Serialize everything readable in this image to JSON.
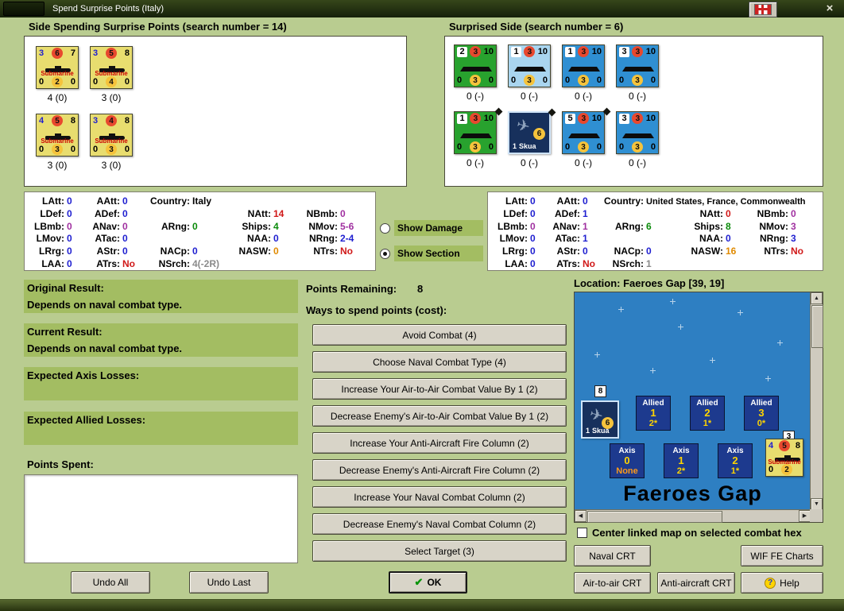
{
  "window": {
    "title": "Spend Surprise Points (Italy)"
  },
  "spending_panel": {
    "header": "Side Spending Surprise Points (search number = 14)",
    "counters": [
      {
        "top_left": "3",
        "top_mid": "6",
        "top_right": "7",
        "unit": "Submarine",
        "bot_left": "0",
        "bot_mid": "2",
        "bot_right": "0",
        "label": "4 (0)"
      },
      {
        "top_left": "3",
        "top_mid": "5",
        "top_right": "8",
        "unit": "Submarine",
        "bot_left": "0",
        "bot_mid": "4",
        "bot_right": "0",
        "label": "3 (0)"
      },
      {
        "top_left": "4",
        "top_mid": "5",
        "top_right": "8",
        "unit": "Submarine",
        "bot_left": "0",
        "bot_mid": "3",
        "bot_right": "0",
        "label": "3 (0)"
      },
      {
        "top_left": "3",
        "top_mid": "4",
        "top_right": "8",
        "unit": "Submarine",
        "bot_left": "0",
        "bot_mid": "3",
        "bot_right": "0",
        "label": "3 (0)"
      }
    ]
  },
  "surprised_panel": {
    "header": "Surprised Side (search number = 6)",
    "counters": [
      {
        "ship": true,
        "cls": "green",
        "top_left": "2",
        "top_mid": "3",
        "top_right": "10",
        "bot_left": "0",
        "bot_mid": "3",
        "bot_right": "0",
        "label": "0 (-)"
      },
      {
        "ship": true,
        "cls": "paleblue",
        "top_left": "1",
        "top_mid": "3",
        "top_right": "10",
        "bot_left": "0",
        "bot_mid": "3",
        "bot_right": "0",
        "label": "0 (-)"
      },
      {
        "ship": true,
        "cls": "blue",
        "top_left": "1",
        "top_mid": "3",
        "top_right": "10",
        "bot_left": "0",
        "bot_mid": "3",
        "bot_right": "0",
        "label": "0 (-)"
      },
      {
        "ship": true,
        "cls": "blue",
        "top_left": "3",
        "top_mid": "3",
        "top_right": "10",
        "bot_left": "0",
        "bot_mid": "3",
        "bot_right": "0",
        "label": "0 (-)"
      },
      {
        "ship": true,
        "cls": "green",
        "diamond": true,
        "top_left": "1",
        "top_mid": "3",
        "top_right": "10",
        "bot_left": "0",
        "bot_mid": "3",
        "bot_right": "0",
        "label": "0 (-)"
      },
      {
        "air": true,
        "cls": "navy selected",
        "diamond": true,
        "num": "1",
        "name": "Skua",
        "value": "6",
        "label": "0 (-)"
      },
      {
        "ship": true,
        "cls": "blue",
        "diamond": true,
        "top_left": "5",
        "top_mid": "3",
        "top_right": "10",
        "bot_left": "0",
        "bot_mid": "3",
        "bot_right": "0",
        "label": "0 (-)"
      },
      {
        "ship": true,
        "cls": "blue",
        "top_left": "3",
        "top_mid": "3",
        "top_right": "10",
        "bot_left": "0",
        "bot_mid": "3",
        "bot_right": "0",
        "label": "0 (-)"
      }
    ]
  },
  "axis_stats": {
    "col1": [
      {
        "l": "LAtt:",
        "v": "0",
        "c": "c-blue"
      },
      {
        "l": "LDef:",
        "v": "0",
        "c": "c-blue"
      },
      {
        "l": "LBmb:",
        "v": "0",
        "c": "c-purple"
      },
      {
        "l": "LMov:",
        "v": "0",
        "c": "c-blue"
      },
      {
        "l": "LRrg:",
        "v": "0",
        "c": "c-blue"
      },
      {
        "l": "LAA:",
        "v": "0",
        "c": "c-blue"
      }
    ],
    "col2": [
      {
        "l": "AAtt:",
        "v": "0",
        "c": "c-blue"
      },
      {
        "l": "ADef:",
        "v": "0",
        "c": "c-blue"
      },
      {
        "l": "ANav:",
        "v": "0",
        "c": "c-purple"
      },
      {
        "l": "ATac:",
        "v": "0",
        "c": "c-blue"
      },
      {
        "l": "AStr:",
        "v": "0",
        "c": "c-blue"
      },
      {
        "l": "ATrs:",
        "v": "No",
        "c": "c-red"
      }
    ],
    "col3": [
      {
        "l": "Country:",
        "v": "Italy",
        "c": "c-country"
      },
      {},
      {
        "l": "ARng:",
        "v": "0",
        "c": "c-green"
      },
      {},
      {
        "l": "NACp:",
        "v": "0",
        "c": "c-blue"
      },
      {
        "l": "NSrch:",
        "v": "4(-2R)",
        "c": "c-gray"
      }
    ],
    "col4": [
      {},
      {
        "l": "NAtt:",
        "v": "14",
        "c": "c-red"
      },
      {
        "l": "Ships:",
        "v": "4",
        "c": "c-green"
      },
      {
        "l": "NAA:",
        "v": "0",
        "c": "c-blue"
      },
      {
        "l": "NASW:",
        "v": "0",
        "c": "c-orange"
      },
      {}
    ],
    "col5": [
      {},
      {
        "l": "NBmb:",
        "v": "0",
        "c": "c-purple"
      },
      {
        "l": "NMov:",
        "v": "5-6",
        "c": "c-purple"
      },
      {
        "l": "NRng:",
        "v": "2-4",
        "c": "c-blue"
      },
      {
        "l": "NTrs:",
        "v": "No",
        "c": "c-red"
      },
      {}
    ]
  },
  "allied_stats": {
    "col1": [
      {
        "l": "LAtt:",
        "v": "0",
        "c": "c-blue"
      },
      {
        "l": "LDef:",
        "v": "0",
        "c": "c-blue"
      },
      {
        "l": "LBmb:",
        "v": "0",
        "c": "c-purple"
      },
      {
        "l": "LMov:",
        "v": "0",
        "c": "c-blue"
      },
      {
        "l": "LRrg:",
        "v": "0",
        "c": "c-blue"
      },
      {
        "l": "LAA:",
        "v": "0",
        "c": "c-blue"
      }
    ],
    "col2": [
      {
        "l": "AAtt:",
        "v": "0",
        "c": "c-blue"
      },
      {
        "l": "ADef:",
        "v": "1",
        "c": "c-blue"
      },
      {
        "l": "ANav:",
        "v": "1",
        "c": "c-purple"
      },
      {
        "l": "ATac:",
        "v": "1",
        "c": "c-blue"
      },
      {
        "l": "AStr:",
        "v": "0",
        "c": "c-blue"
      },
      {
        "l": "ATrs:",
        "v": "No",
        "c": "c-red"
      }
    ],
    "col3": [
      {
        "l": "Country:",
        "v": "United States, France, Commonwealth",
        "c": "c-country"
      },
      {},
      {
        "l": "ARng:",
        "v": "6",
        "c": "c-green"
      },
      {},
      {
        "l": "NACp:",
        "v": "0",
        "c": "c-blue"
      },
      {
        "l": "NSrch:",
        "v": "1",
        "c": "c-gray"
      }
    ],
    "col4": [
      {},
      {
        "l": "NAtt:",
        "v": "0",
        "c": "c-red"
      },
      {
        "l": "Ships:",
        "v": "8",
        "c": "c-green"
      },
      {
        "l": "NAA:",
        "v": "0",
        "c": "c-blue"
      },
      {
        "l": "NASW:",
        "v": "16",
        "c": "c-orange"
      },
      {}
    ],
    "col5": [
      {},
      {
        "l": "NBmb:",
        "v": "0",
        "c": "c-purple"
      },
      {
        "l": "NMov:",
        "v": "3",
        "c": "c-purple"
      },
      {
        "l": "NRng:",
        "v": "3",
        "c": "c-blue"
      },
      {
        "l": "NTrs:",
        "v": "No",
        "c": "c-red"
      },
      {}
    ]
  },
  "view_options": {
    "damage": "Show Damage",
    "section": "Show Section"
  },
  "results": {
    "original_label": "Original Result:",
    "original_value": "Depends on naval combat type.",
    "current_label": "Current Result:",
    "current_value": "Depends on naval combat type.",
    "axis_losses_label": "Expected Axis Losses:",
    "allied_losses_label": "Expected Allied Losses:",
    "points_spent_label": "Points Spent:"
  },
  "actions": {
    "undo_all": "Undo All",
    "undo_last": "Undo Last"
  },
  "spend": {
    "points_label": "Points Remaining:",
    "points_value": "8",
    "ways_label": "Ways to spend points (cost):",
    "options": [
      {
        "t": "Avoid Combat (4)",
        "cls": "def"
      },
      {
        "t": "Choose Naval Combat Type (4)",
        "cls": "def"
      },
      {
        "t": "Increase Your Air-to-Air Combat Value By 1 (2)"
      },
      {
        "t": "Decrease Enemy's Air-to-Air Combat Value By 1 (2)"
      },
      {
        "t": "Increase Your Anti-Aircraft Fire Column (2)"
      },
      {
        "t": "Decrease Enemy's Anti-Aircraft Fire Column (2)"
      },
      {
        "t": "Increase Your Naval Combat Column (2)"
      },
      {
        "t": "Decrease Enemy's Naval Combat Column (2)"
      },
      {
        "t": "Select Target (3)"
      }
    ],
    "ok_label": "OK"
  },
  "map": {
    "location_label": "Location: Faeroes Gap [39, 19]",
    "hex_name": "Faeroes Gap",
    "badge_air": "8",
    "badge_sub": "3",
    "air_counter": {
      "num": "1",
      "name": "Skua",
      "value": "6"
    },
    "sub_counter": {
      "top_left": "4",
      "top_mid": "5",
      "top_right": "8",
      "unit": "Submarine",
      "bot_left": "0",
      "bot_mid": "2",
      "bot_right": ""
    },
    "groups": [
      {
        "side": "Allied",
        "num": "1",
        "val": "2*"
      },
      {
        "side": "Allied",
        "num": "2",
        "val": "1*"
      },
      {
        "side": "Allied",
        "num": "3",
        "val": "0*"
      },
      {
        "side": "Axis",
        "num": "0",
        "val": "None"
      },
      {
        "side": "Axis",
        "num": "1",
        "val": "2*"
      },
      {
        "side": "Axis",
        "num": "2",
        "val": "1*"
      }
    ],
    "center_label": "Center linked map on selected combat hex"
  },
  "footer": {
    "naval_crt": "Naval CRT",
    "wif_charts": "WIF FE Charts",
    "air_crt": "Air-to-air CRT",
    "aa_crt": "Anti-aircraft CRT",
    "help": "Help"
  }
}
